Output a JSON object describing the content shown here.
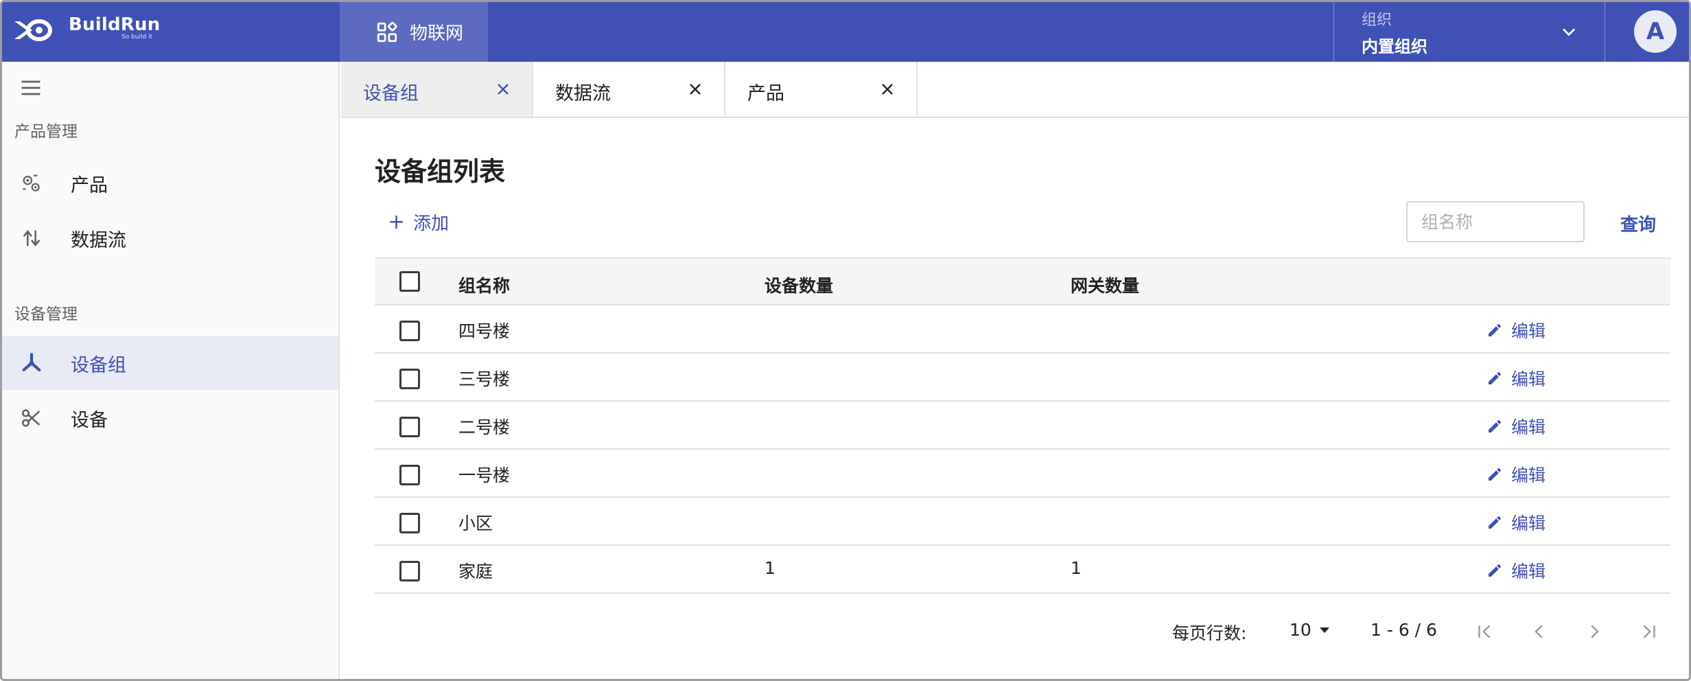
{
  "brand": {
    "name": "BuildRun",
    "tagline": "So build it"
  },
  "topbar": {
    "app_tab_label": "物联网",
    "org_label": "组织",
    "org_value": "内置组织",
    "avatar_initial": "A"
  },
  "sidebar": {
    "section_product": "产品管理",
    "item_product": "产品",
    "item_dataflow": "数据流",
    "section_device": "设备管理",
    "item_device_group": "设备组",
    "item_device": "设备"
  },
  "tabs": [
    {
      "label": "设备组",
      "active": true
    },
    {
      "label": "数据流",
      "active": false
    },
    {
      "label": "产品",
      "active": false
    }
  ],
  "main": {
    "title": "设备组列表",
    "add_label": "添加",
    "search_placeholder": "组名称",
    "query_label": "查询"
  },
  "table": {
    "columns": [
      "组名称",
      "设备数量",
      "网关数量"
    ],
    "edit_label": "编辑",
    "rows": [
      {
        "name": "四号楼",
        "devices": "",
        "gateways": ""
      },
      {
        "name": "三号楼",
        "devices": "",
        "gateways": ""
      },
      {
        "name": "二号楼",
        "devices": "",
        "gateways": ""
      },
      {
        "name": "一号楼",
        "devices": "",
        "gateways": ""
      },
      {
        "name": "小区",
        "devices": "",
        "gateways": ""
      },
      {
        "name": "家庭",
        "devices": "1",
        "gateways": "1"
      }
    ]
  },
  "pagination": {
    "rows_per_page_label": "每页行数:",
    "rows_per_page": "10",
    "range": "1 - 6 / 6"
  },
  "colors": {
    "primary": "#3f51b5",
    "primary_light": "#5c6bc0",
    "active_bg": "#e8eaf6"
  }
}
